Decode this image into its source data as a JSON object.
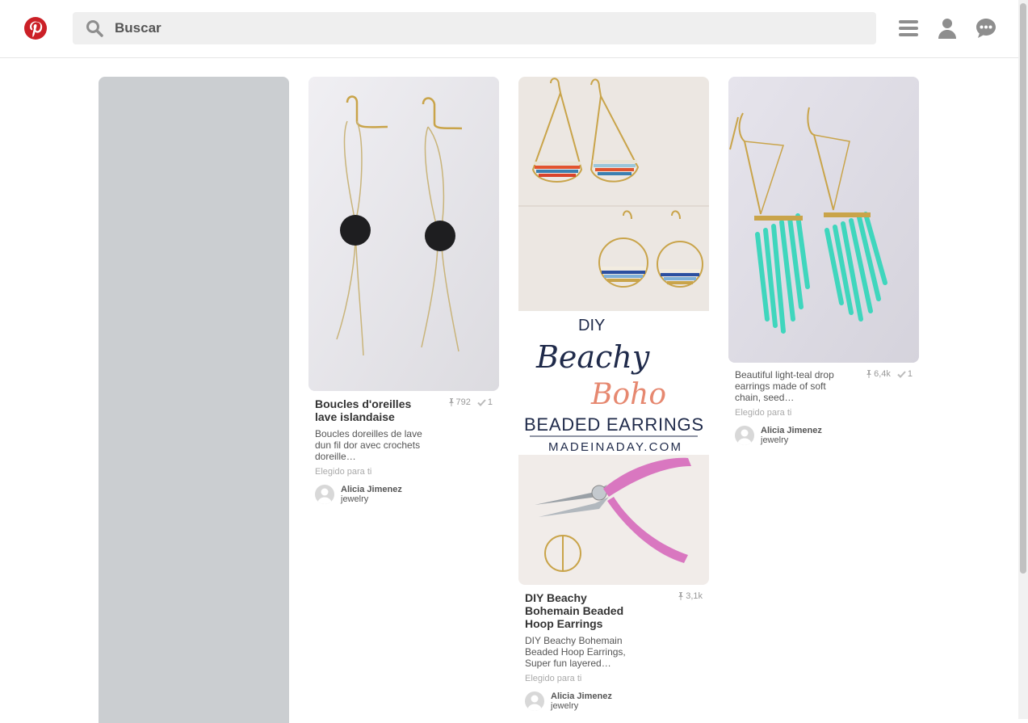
{
  "header": {
    "search_placeholder": "Buscar"
  },
  "colors": {
    "brand": "#cb2027",
    "search_bg": "#efefef",
    "placeholder_pin": "#cbced1"
  },
  "icons": [
    "pinterest-logo-icon",
    "search-icon",
    "menu-icon",
    "profile-icon",
    "messages-icon"
  ],
  "pins": [
    {
      "title": "Boucles d'oreilles lave islandaise",
      "repins": "792",
      "likes": "1",
      "description": "Boucles doreilles de lave dun fil dor avec crochets doreille…",
      "picked": "Elegido para ti",
      "owner": "Alicia Jimenez",
      "board": "jewelry"
    },
    {
      "title": "DIY Beachy Bohemain Beaded Hoop Earrings",
      "repins": "3,1k",
      "description": "DIY Beachy Bohemain Beaded Hoop Earrings, Super fun layered…",
      "picked": "Elegido para ti",
      "owner": "Alicia Jimenez",
      "board": "jewelry",
      "image_text": {
        "line1": "DIY",
        "line2": "Beachy",
        "line3": "Boho",
        "line4": "BEADED EARRINGS",
        "line5": "MADEINADAY.COM"
      }
    },
    {
      "repins": "6,4k",
      "likes": "1",
      "description": "Beautiful light-teal drop earrings made of soft chain, seed…",
      "picked": "Elegido para ti",
      "owner": "Alicia Jimenez",
      "board": "jewelry"
    }
  ]
}
